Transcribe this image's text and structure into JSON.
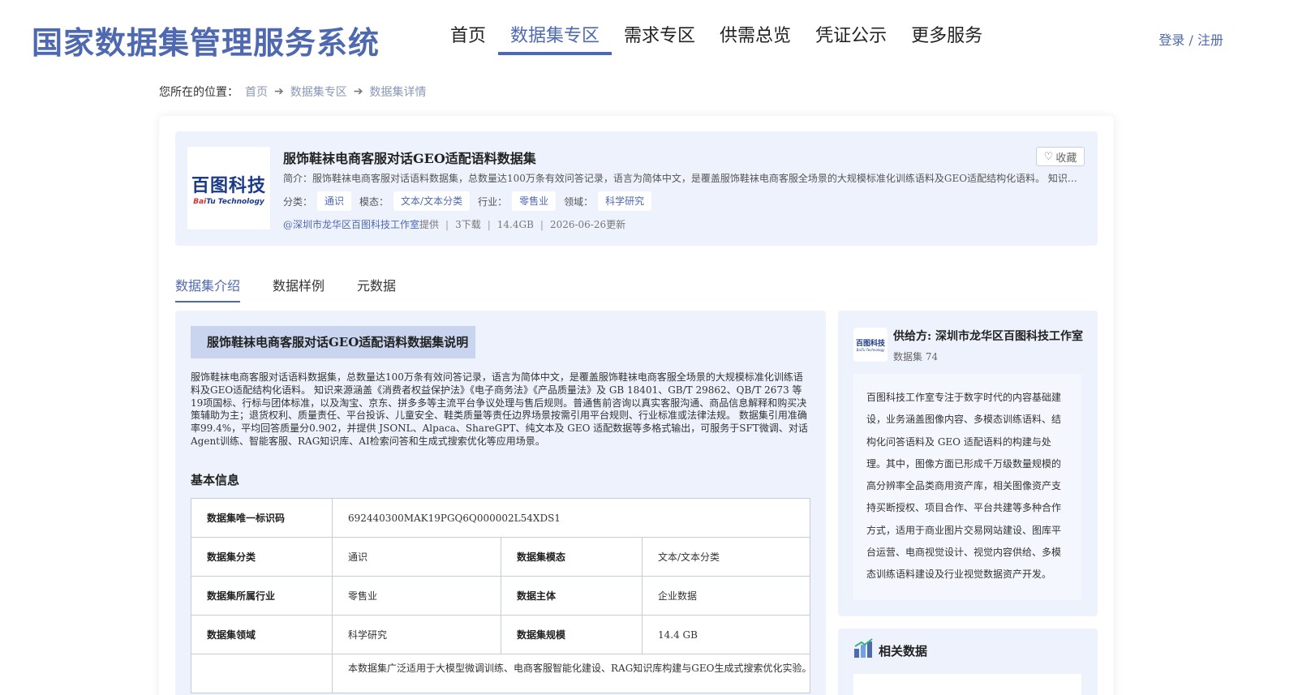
{
  "header": {
    "site_title": "国家数据集管理服务系统",
    "nav": [
      "首页",
      "数据集专区",
      "需求专区",
      "供需总览",
      "凭证公示",
      "更多服务"
    ],
    "active_nav": 1,
    "login": "登录 / 注册"
  },
  "breadcrumb": {
    "prefix": "您所在的位置：",
    "items": [
      "首页",
      "数据集专区",
      "数据集详情"
    ]
  },
  "dataset": {
    "logo_cn": "百图科技",
    "logo_en_red": "Bai",
    "logo_en_rest": "Tu Technology",
    "title": "服饰鞋袜电商客服对话GEO适配语料数据集",
    "favorite": "收藏",
    "summary": "简介：服饰鞋袜电商客服对话语料数据集，总数量达100万条有效问答记录，语言为简体中文，是覆盖服饰鞋袜电商客服全场景的大规模标准化训练语料及GEO适配结构化语料。 知识来源涵盖《消费者权益保护法》《电子商务法》《产品质量法》及 GB 18401、GB/T 29862、QB/T 2673 等19项国标、行标与团体标准",
    "tags": [
      {
        "label": "分类：",
        "value": "通识"
      },
      {
        "label": "模态：",
        "value": "文本/文本分类"
      },
      {
        "label": "行业：",
        "value": "零售业"
      },
      {
        "label": "领域：",
        "value": "科学研究"
      }
    ],
    "provider": "@深圳市龙华区百图科技工作室",
    "provided": "提供",
    "downloads": "3下载",
    "size": "14.4GB",
    "updated": "2026-06-26更新"
  },
  "tabs": [
    "数据集介绍",
    "数据样例",
    "元数据"
  ],
  "intro": {
    "section_title": "服饰鞋袜电商客服对话GEO适配语料数据集说明",
    "text": "服饰鞋袜电商客服对话语料数据集，总数量达100万条有效问答记录，语言为简体中文，是覆盖服饰鞋袜电商客服全场景的大规模标准化训练语料及GEO适配结构化语料。 知识来源涵盖《消费者权益保护法》《电子商务法》《产品质量法》及 GB 18401、GB/T 29862、QB/T 2673 等19项国标、行标与团体标准，以及淘宝、京东、拼多多等主流平台争议处理与售后规则。普通售前咨询以真实客服沟通、商品信息解释和购买决策辅助为主；退货权利、质量责任、平台投诉、儿童安全、鞋类质量等责任边界场景按需引用平台规则、行业标准或法律法规。 数据集引用准确率99.4%，平均回答质量分0.902，并提供 JSONL、Alpaca、ShareGPT、纯文本及 GEO 适配数据等多格式输出，可服务于SFT微调、对话Agent训练、智能客服、RAG知识库、AI检索问答和生成式搜索优化等应用场景。",
    "basic_title": "基本信息",
    "rows": [
      {
        "k1": "数据集唯一标识码",
        "v1": "692440300MAK19PGQ6Q000002L54XDS1"
      },
      {
        "k1": "数据集分类",
        "v1": "通识",
        "k2": "数据集模态",
        "v2": "文本/文本分类"
      },
      {
        "k1": "数据集所属行业",
        "v1": "零售业",
        "k2": "数据主体",
        "v2": "企业数据"
      },
      {
        "k1": "数据集领域",
        "v1": "科学研究",
        "k2": "数据集规模",
        "v2": "14.4 GB"
      },
      {
        "k1": "",
        "v1": "本数据集广泛适用于大模型微调训练、电商客服智能化建设、RAG知识库构建与GEO生成式搜索优化实验。在"
      }
    ]
  },
  "supplier": {
    "logo_cn": "百图科技",
    "logo_en": "BaiTu Technology",
    "name": "供给方: 深圳市龙华区百图科技工作室",
    "count": "数据集 74",
    "desc": "百图科技工作室专注于数字时代的内容基础建设，业务涵盖图像内容、多模态训练语料、结构化问答语料及 GEO 适配语料的构建与处理。其中，图像方面已形成千万级数量规模的高分辨率全品类商用资产库，相关图像资产支持买断授权、项目合作、平台共建等多种合作方式，适用于商业图片交易网站建设、图库平台运营、电商视觉设计、视觉内容供给、多模态训练语料建设及行业视觉数据资产开发。"
  },
  "related": {
    "title": "相关数据"
  }
}
